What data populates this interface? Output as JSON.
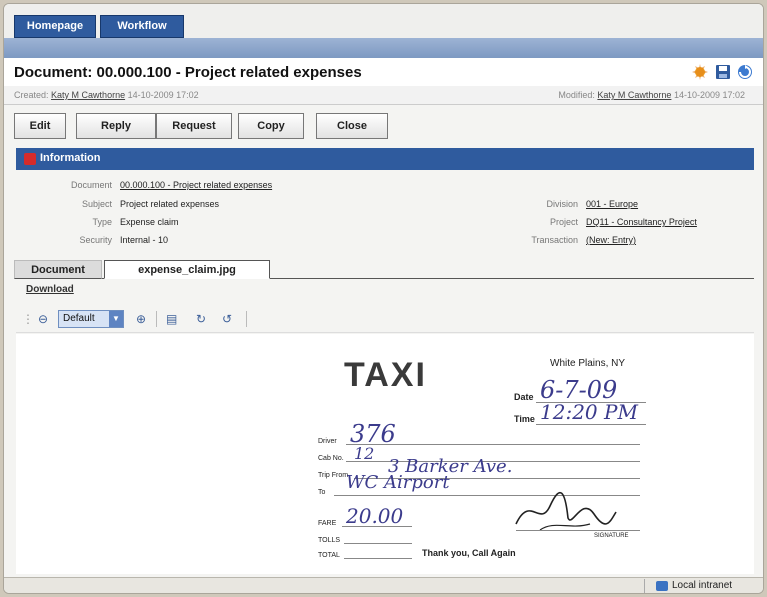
{
  "nav": {
    "tabs": [
      {
        "label": "Homepage"
      },
      {
        "label": "Workflow"
      }
    ]
  },
  "document": {
    "title": "Document: 00.000.100 - Project related expenses",
    "created_label": "Created:",
    "created_by": "Katy M Cawthorne",
    "created_at": "14-10-2009 17:02",
    "modified_label": "Modified:",
    "modified_by": "Katy M Cawthorne",
    "modified_at": "14-10-2009 17:02"
  },
  "toolbar_icons": [
    "star-icon",
    "save-icon",
    "refresh-icon"
  ],
  "buttons": {
    "edit": "Edit",
    "reply": "Reply",
    "request": "Request",
    "copy": "Copy",
    "close": "Close"
  },
  "information": {
    "title": "Information",
    "fields": {
      "document": {
        "label": "Document",
        "value": "00.000.100 - Project related expenses"
      },
      "subject": {
        "label": "Subject",
        "value": "Project related expenses"
      },
      "type": {
        "label": "Type",
        "value": "Expense claim"
      },
      "security": {
        "label": "Security",
        "value": "Internal - 10"
      },
      "division": {
        "label": "Division",
        "value": "001 - Europe"
      },
      "project": {
        "label": "Project",
        "value": "DQ11 - Consultancy Project"
      },
      "transaction": {
        "label": "Transaction",
        "value": "(New: Entry)"
      }
    }
  },
  "doc_tabs": {
    "document": "Document",
    "file": "expense_claim.jpg"
  },
  "download": "Download",
  "viewer": {
    "zoom_select": "Default"
  },
  "receipt": {
    "brand": "TAXI",
    "location": "White Plains, NY",
    "date_label": "Date",
    "date_value": "6-7-09",
    "time_label": "Time",
    "time_value": "12:20 PM",
    "driver_label": "Driver",
    "driver_value": "376",
    "cab_label": "Cab No.",
    "cab_value": "12",
    "trip_from_label": "Trip From",
    "trip_from_value": "3 Barker Ave.",
    "to_label": "To",
    "to_value": "WC Airport",
    "fare_label": "FARE",
    "fare_value": "20.00",
    "tolls_label": "TOLLS",
    "total_label": "TOTAL",
    "thanks": "Thank you, Call Again",
    "signature_label": "SIGNATURE"
  },
  "status_bar": {
    "zone": "Local intranet"
  },
  "colors": {
    "header_blue": "#2f5b9e",
    "accent_red": "#d42b2b"
  }
}
